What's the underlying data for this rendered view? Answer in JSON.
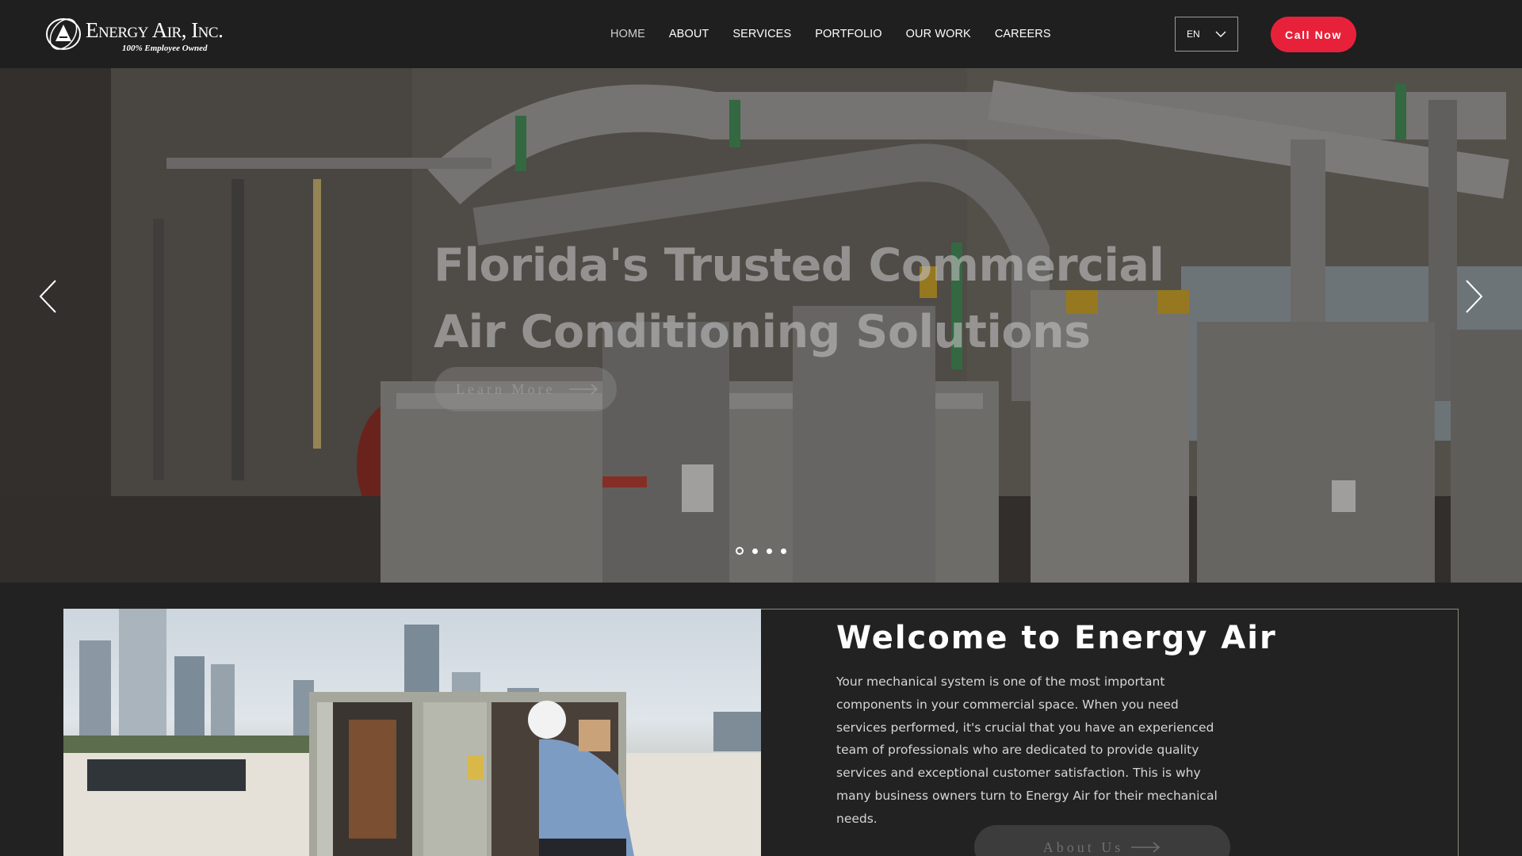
{
  "header": {
    "logo_name": "Energy Air, Inc.",
    "logo_tagline": "100% Employee Owned",
    "nav": [
      {
        "label": "HOME",
        "active": true
      },
      {
        "label": "ABOUT"
      },
      {
        "label": "SERVICES"
      },
      {
        "label": "PORTFOLIO"
      },
      {
        "label": "OUR WORK"
      },
      {
        "label": "CAREERS"
      }
    ],
    "language": "EN",
    "call_button": "Call Now"
  },
  "hero": {
    "title": "Florida's Trusted Commercial Air Conditioning Solutions",
    "cta_label": "Learn More",
    "slide_count": 4,
    "active_slide": 1,
    "icons": [
      "chevron-left-icon",
      "chevron-right-icon"
    ]
  },
  "welcome": {
    "title": "Welcome to Energy Air",
    "body": "Your mechanical system is one of the most important components in your commercial space. When you need services performed, it's crucial that you have an experienced team of professionals who are dedicated to provide quality services and exceptional customer satisfaction. This is why many business owners turn to Energy Air for their mechanical needs.",
    "cta_label": "About Us"
  },
  "colors": {
    "header_bg": "#1f1f1f",
    "page_bg": "#222222",
    "accent": "#e8213a"
  }
}
